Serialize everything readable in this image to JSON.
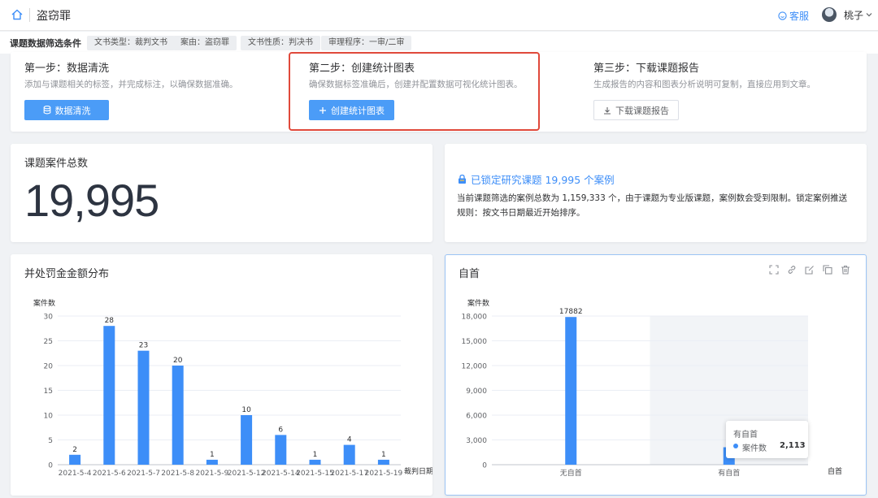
{
  "topbar": {
    "title": "盗窃罪",
    "service_label": "客服",
    "user_name": "桃子",
    "accent": "#3d8ef8"
  },
  "filter": {
    "label": "课题数据筛选条件",
    "tags": [
      "文书类型：裁判文书",
      "案由：盗窃罪",
      "文书性质：判决书",
      "审理程序：一审/二审"
    ]
  },
  "steps": [
    {
      "title": "第一步：数据清洗",
      "desc": "添加与课题相关的标签，并完成标注，以确保数据准确。",
      "button": "数据清洗",
      "icon": "database-icon"
    },
    {
      "title": "第二步：创建统计图表",
      "desc": "确保数据标签准确后，创建并配置数据可视化统计图表。",
      "button": "创建统计图表",
      "icon": "plus-icon"
    },
    {
      "title": "第三步：下载课题报告",
      "desc": "生成报告的内容和图表分析说明可复制，直接应用到文章。",
      "button": "下载课题报告",
      "icon": "download-icon"
    }
  ],
  "total": {
    "title": "课题案件总数",
    "value": "19,995"
  },
  "lock": {
    "headline": "已锁定研究课题 19,995 个案例",
    "desc": "当前课题筛选的案例总数为 1,159,333 个，由于课题为专业版课题，案例数会受到限制。锁定案例推送规则：按文书日期最近开始排序。"
  },
  "chart_left_title": "并处罚金金额分布",
  "chart_right_title": "自首",
  "tooltip": {
    "title": "有自首",
    "label": "案件数",
    "value": "2,113",
    "color": "#3d8ef8"
  },
  "chart_data": [
    {
      "type": "bar",
      "title": "并处罚金金额分布",
      "ylabel": "案件数",
      "xlabel": "裁判日期",
      "categories": [
        "2021-5-4",
        "2021-5-6",
        "2021-5-7",
        "2021-5-8",
        "2021-5-9",
        "2021-5-12",
        "2021-5-14",
        "2021-5-15",
        "2021-5-17",
        "2021-5-19"
      ],
      "display_categories": [
        "2021-5-4",
        "2021-5-6",
        "2021-5-7",
        "2021-5-8",
        "2021-5-9",
        "2021-5-12",
        "2021-5-14",
        "2021-5-15",
        "2021-5-17",
        "2021-5-19"
      ],
      "values": [
        2,
        28,
        23,
        20,
        1,
        10,
        6,
        1,
        4,
        1
      ],
      "yticks": [
        "0",
        "5",
        "10",
        "15",
        "20",
        "25",
        "30"
      ],
      "ylim": [
        0,
        30
      ],
      "color": "#3d8ef8",
      "grid": true
    },
    {
      "type": "bar",
      "title": "自首",
      "ylabel": "案件数",
      "xlabel": "自首",
      "categories": [
        "无自首",
        "有自首"
      ],
      "values": [
        17882,
        2113
      ],
      "labels": [
        "17882",
        ""
      ],
      "yticks": [
        "0",
        "3,000",
        "6,000",
        "9,000",
        "12,000",
        "15,000",
        "18,000"
      ],
      "ylim": [
        0,
        18000
      ],
      "color": "#3d8ef8",
      "grid": true
    }
  ]
}
